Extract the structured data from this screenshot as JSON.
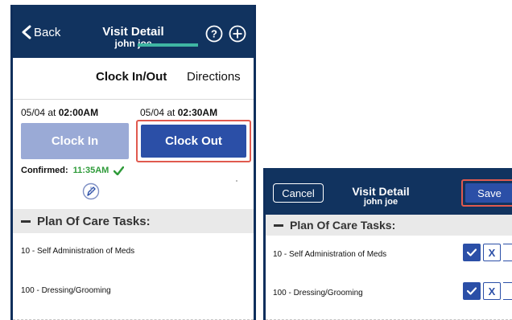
{
  "left": {
    "header": {
      "back_label": "Back",
      "title": "Visit Detail",
      "subtitle": "john joe"
    },
    "tabs": {
      "clock": "Clock In/Out",
      "directions": "Directions"
    },
    "clock_in": {
      "date": "05/04 at ",
      "time": "02:00AM",
      "button": "Clock In"
    },
    "clock_out": {
      "date": "05/04 at ",
      "time": "02:30AM",
      "button": "Clock Out"
    },
    "confirmed": {
      "label": "Confirmed:",
      "time": "11:35AM"
    },
    "plan_of_care": {
      "label": "Plan Of Care Tasks:"
    },
    "tasks": [
      "10 - Self Administration of Meds",
      "100 - Dressing/Grooming"
    ],
    "colors": {
      "header": "#11335f",
      "primary": "#2b4fa7",
      "disabled": "#9aaad6",
      "tab_underline": "#3fb6a3",
      "highlight": "#e05a4f",
      "confirmed": "#2f9b3a"
    }
  },
  "right": {
    "header": {
      "cancel_label": "Cancel",
      "title": "Visit Detail",
      "subtitle": "john joe",
      "save_label": "Save"
    },
    "plan_of_care": {
      "label": "Plan Of Care Tasks:"
    },
    "tasks": [
      "10 - Self Administration of Meds",
      "100 - Dressing/Grooming"
    ],
    "x_label": "X"
  }
}
